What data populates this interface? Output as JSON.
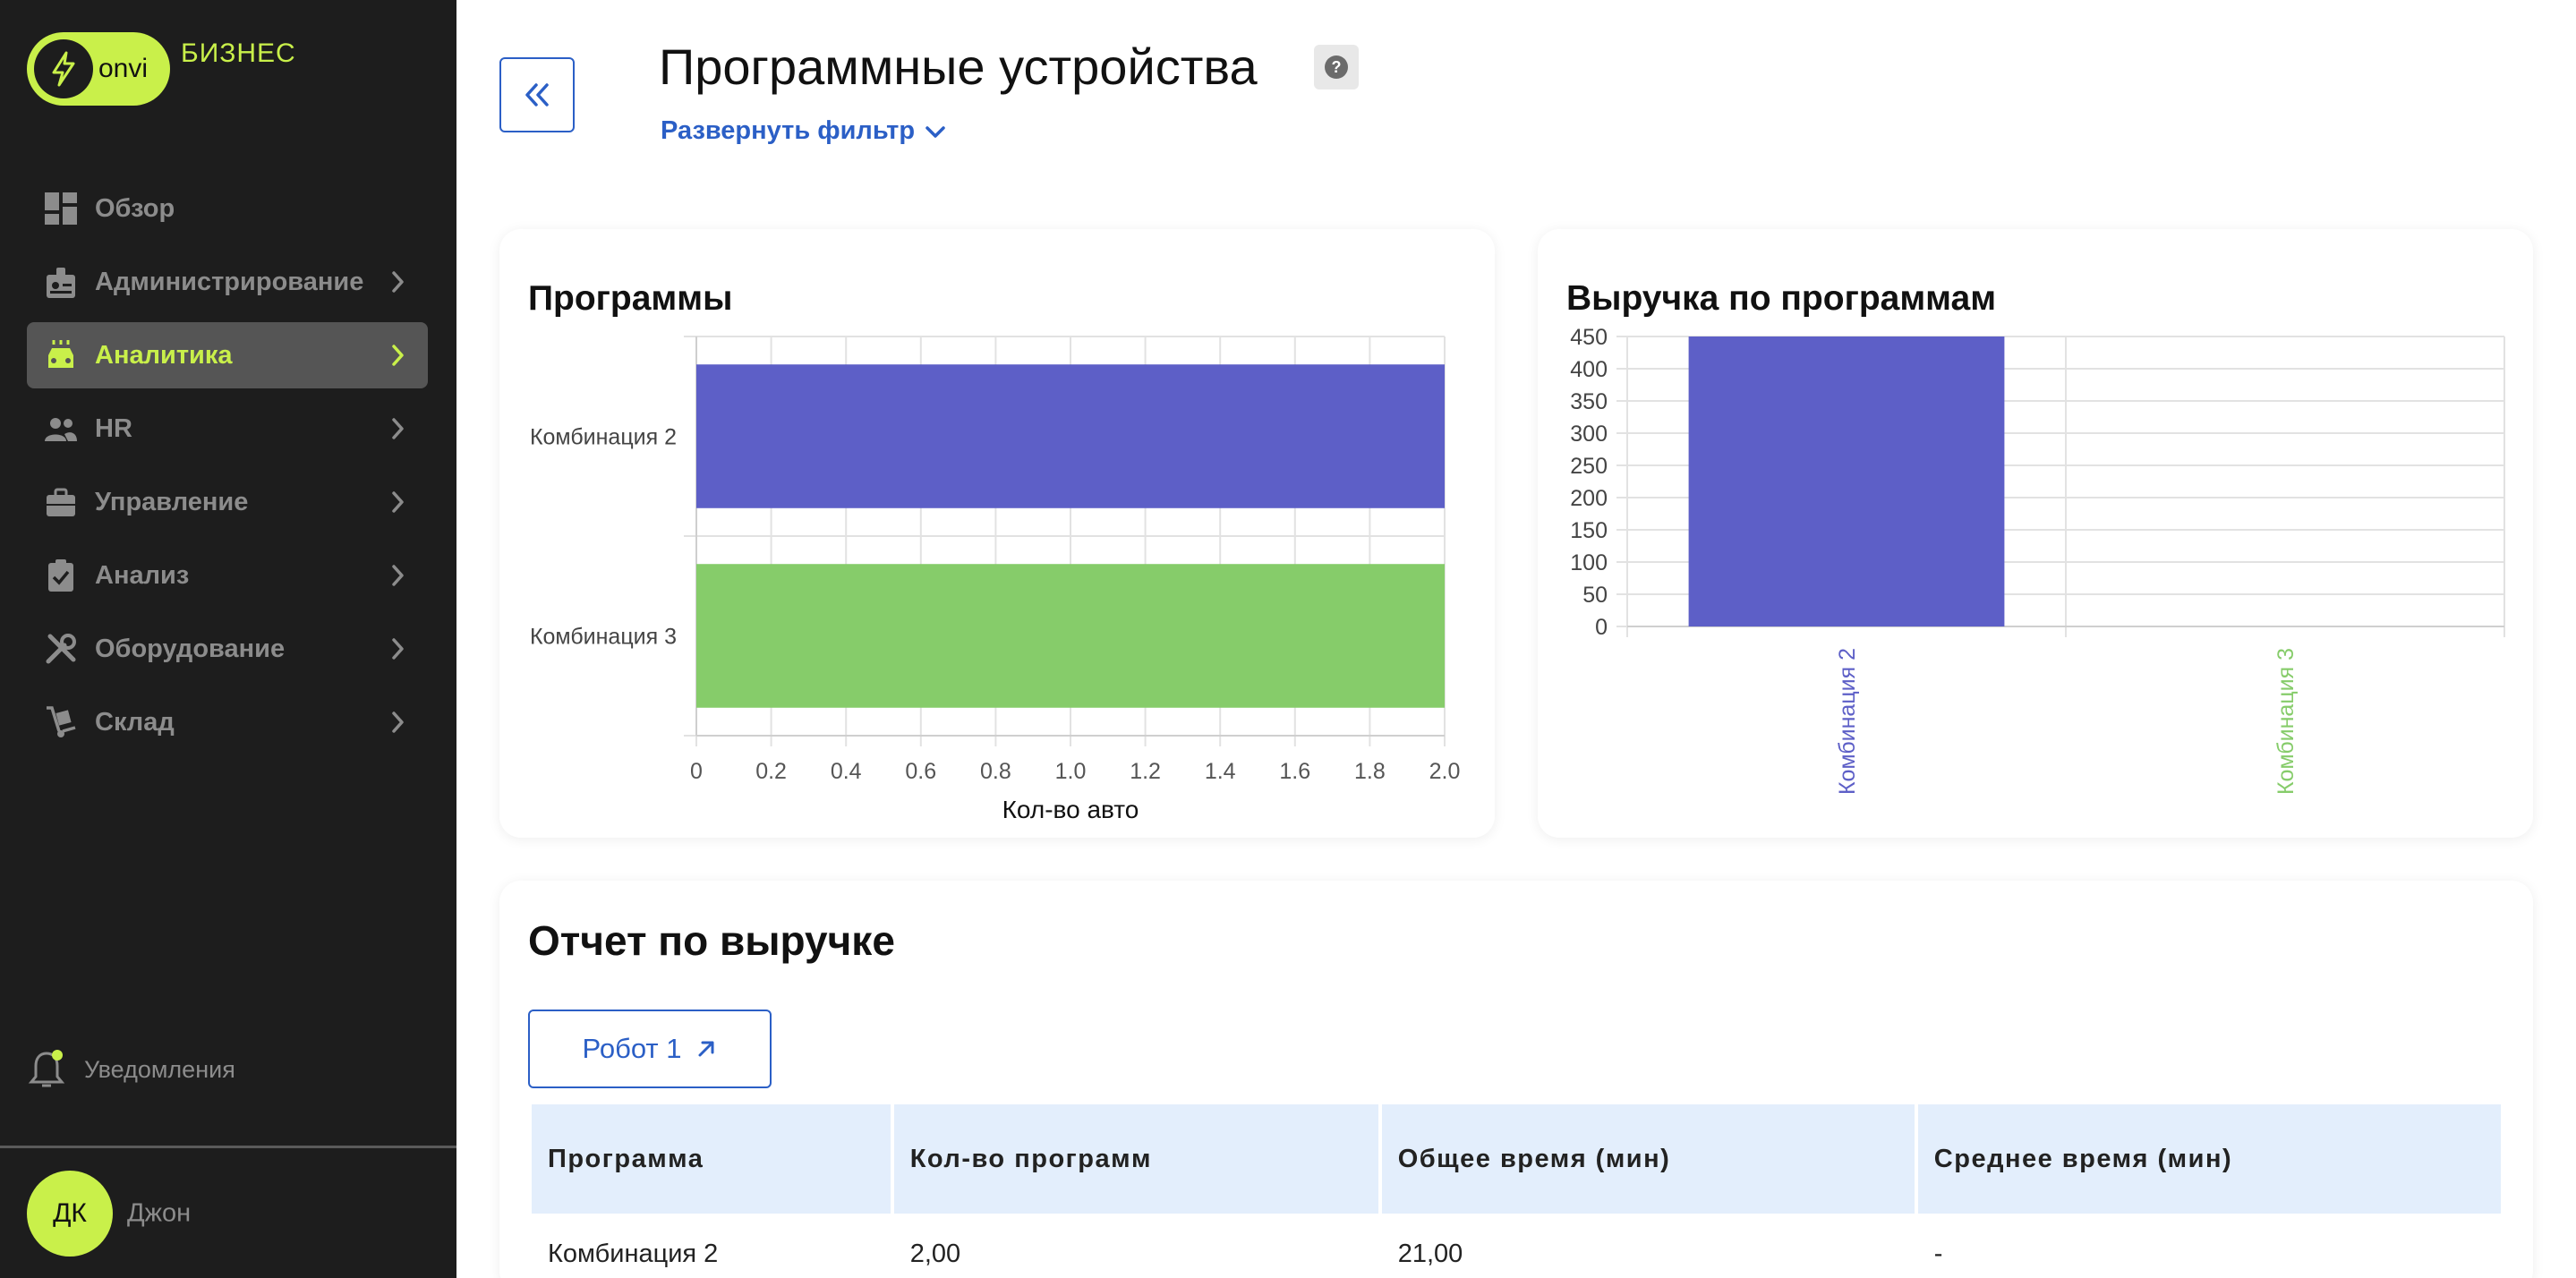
{
  "brand": {
    "logo_text": "onvi",
    "product": "БИЗНЕС",
    "accent": "#c9f04a"
  },
  "sidebar": {
    "items": [
      {
        "label": "Обзор",
        "icon": "dashboard-icon",
        "has_chevron": false,
        "active": false
      },
      {
        "label": "Администрирование",
        "icon": "badge-icon",
        "has_chevron": true,
        "active": false
      },
      {
        "label": "Аналитика",
        "icon": "car-wash-icon",
        "has_chevron": true,
        "active": true
      },
      {
        "label": "HR",
        "icon": "people-icon",
        "has_chevron": true,
        "active": false
      },
      {
        "label": "Управление",
        "icon": "briefcase-icon",
        "has_chevron": true,
        "active": false
      },
      {
        "label": "Анализ",
        "icon": "clipboard-check-icon",
        "has_chevron": true,
        "active": false
      },
      {
        "label": "Оборудование",
        "icon": "tools-icon",
        "has_chevron": true,
        "active": false
      },
      {
        "label": "Склад",
        "icon": "dolly-icon",
        "has_chevron": true,
        "active": false
      }
    ],
    "notifications_label": "Уведомления",
    "user": {
      "initials": "ДК",
      "name": "Джон"
    }
  },
  "header": {
    "title": "Программные устройства",
    "help": "?",
    "filter_label": "Развернуть фильтр"
  },
  "programs_card": {
    "title": "Программы"
  },
  "revenue_card": {
    "title": "Выручка по программам"
  },
  "chart_data": [
    {
      "type": "bar",
      "orientation": "horizontal",
      "title": "Программы",
      "categories": [
        "Комбинация 2",
        "Комбинация 3"
      ],
      "values": [
        2,
        2
      ],
      "colors": [
        "#5d5fc7",
        "#86cc6a"
      ],
      "xlabel": "Кол-во авто",
      "xlim": [
        0,
        2
      ],
      "xticks": [
        "0",
        "0.2",
        "0.4",
        "0.6",
        "0.8",
        "1.0",
        "1.2",
        "1.4",
        "1.6",
        "1.8",
        "2.0"
      ],
      "grid": true
    },
    {
      "type": "bar",
      "orientation": "vertical",
      "title": "Выручка по программам",
      "categories": [
        "Комбинация 2",
        "Комбинация 3"
      ],
      "values": [
        450,
        0
      ],
      "colors": [
        "#5d5fc7",
        "#86cc6a"
      ],
      "ylim": [
        0,
        450
      ],
      "yticks": [
        "0",
        "50",
        "100",
        "150",
        "200",
        "250",
        "300",
        "350",
        "400",
        "450"
      ],
      "grid": true
    }
  ],
  "report": {
    "title": "Отчет по выручке",
    "device_button": "Робот 1",
    "columns": [
      "Программа",
      "Кол-во программ",
      "Общее время (мин)",
      "Среднее время (мин)"
    ],
    "rows": [
      [
        "Комбинация 2",
        "2,00",
        "21,00",
        "-"
      ]
    ]
  }
}
